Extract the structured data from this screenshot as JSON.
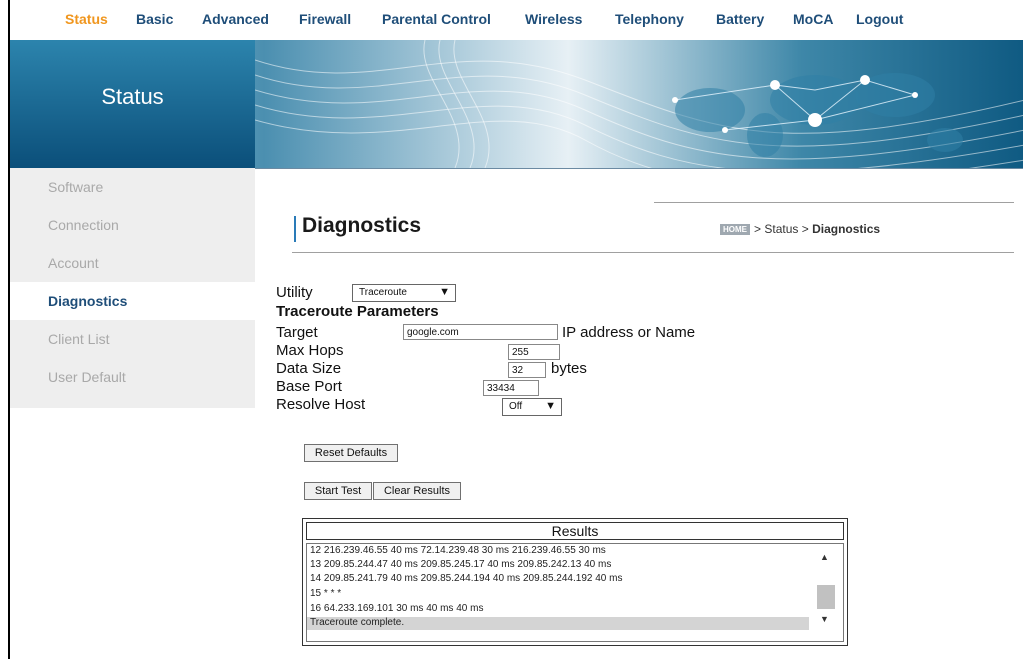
{
  "nav": {
    "items": [
      "Status",
      "Basic",
      "Advanced",
      "Firewall",
      "Parental Control",
      "Wireless",
      "Telephony",
      "Battery",
      "MoCA",
      "Logout"
    ],
    "active": "Status"
  },
  "banner": {
    "title": "Status"
  },
  "sidebar": {
    "items": [
      "Software",
      "Connection",
      "Account",
      "Diagnostics",
      "Client List",
      "User Default"
    ],
    "active": "Diagnostics"
  },
  "page": {
    "title": "Diagnostics",
    "breadcrumb": {
      "home": "HOME",
      "sep": ">",
      "parent": "Status",
      "current": "Diagnostics"
    }
  },
  "form": {
    "utility_label": "Utility",
    "utility_value": "Traceroute",
    "section_title": "Traceroute Parameters",
    "target_label": "Target",
    "target_value": "google.com",
    "target_hint": "IP address or Name",
    "maxhops_label": "Max Hops",
    "maxhops_value": "255",
    "datasize_label": "Data Size",
    "datasize_value": "32",
    "datasize_unit": "bytes",
    "baseport_label": "Base Port",
    "baseport_value": "33434",
    "resolve_label": "Resolve Host",
    "resolve_value": "Off",
    "reset_button": "Reset Defaults",
    "start_button": "Start Test",
    "clear_button": "Clear Results"
  },
  "results": {
    "title": "Results",
    "lines": [
      "12 216.239.46.55 40 ms 72.14.239.48 30 ms 216.239.46.55 30 ms",
      "13 209.85.244.47 40 ms 209.85.245.17 40 ms 209.85.242.13 40 ms",
      "14 209.85.241.79 40 ms 209.85.244.194 40 ms 209.85.244.192 40 ms",
      "15 * * *",
      "16 64.233.169.101 30 ms 40 ms 40 ms",
      "Traceroute complete."
    ]
  },
  "icons": {
    "dropdown": "chevron-down-icon",
    "scroll_up": "arrow-up-icon",
    "scroll_down": "arrow-down-icon"
  },
  "colors": {
    "nav_link": "#1f4e79",
    "nav_active": "#f0961e",
    "banner": "#0b4f7a",
    "sidebar_bg": "#eeeeee"
  }
}
